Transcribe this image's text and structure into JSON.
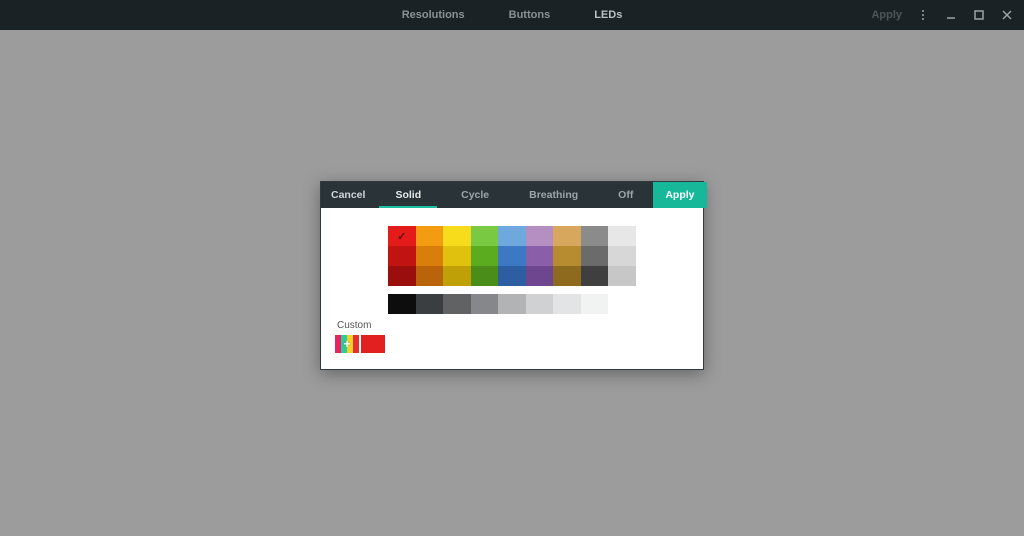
{
  "header": {
    "tabs": [
      {
        "label": "Resolutions",
        "active": false
      },
      {
        "label": "Buttons",
        "active": false
      },
      {
        "label": "LEDs",
        "active": true
      }
    ],
    "apply_label": "Apply"
  },
  "dialog": {
    "cancel_label": "Cancel",
    "apply_label": "Apply",
    "tabs": [
      {
        "label": "Solid",
        "active": true
      },
      {
        "label": "Cycle",
        "active": false
      },
      {
        "label": "Breathing",
        "active": false
      },
      {
        "label": "Off",
        "active": false
      }
    ],
    "palette": {
      "rows": [
        [
          {
            "hex": "#e31b1b",
            "selected": true
          },
          {
            "hex": "#f39c12"
          },
          {
            "hex": "#f7dc1b"
          },
          {
            "hex": "#7ac943"
          },
          {
            "hex": "#6fa8dc"
          },
          {
            "hex": "#b58fc1"
          },
          {
            "hex": "#d6a75c"
          },
          {
            "hex": "#8b8b8b"
          },
          {
            "hex": "#e7e7e7"
          }
        ],
        [
          {
            "hex": "#c21313"
          },
          {
            "hex": "#d97e0b"
          },
          {
            "hex": "#e0c20e"
          },
          {
            "hex": "#5bad1f"
          },
          {
            "hex": "#3c78c4"
          },
          {
            "hex": "#8a5ea9"
          },
          {
            "hex": "#b78b30"
          },
          {
            "hex": "#6b6b6b"
          },
          {
            "hex": "#d7d7d7"
          }
        ],
        [
          {
            "hex": "#9a0e0e"
          },
          {
            "hex": "#b9640a"
          },
          {
            "hex": "#c0a007"
          },
          {
            "hex": "#4b8d19"
          },
          {
            "hex": "#2d5ea2"
          },
          {
            "hex": "#6e4690"
          },
          {
            "hex": "#8d6a1e"
          },
          {
            "hex": "#3f3f3f"
          },
          {
            "hex": "#c7c7c7"
          }
        ]
      ],
      "neutral_row": [
        {
          "hex": "#0d0d0d"
        },
        {
          "hex": "#3b3e40"
        },
        {
          "hex": "#606264"
        },
        {
          "hex": "#85878a"
        },
        {
          "hex": "#b1b3b5"
        },
        {
          "hex": "#cfd1d2"
        },
        {
          "hex": "#e3e4e5"
        },
        {
          "hex": "#f1f2f2"
        },
        {
          "hex": "#ffffff"
        }
      ]
    },
    "custom": {
      "label": "Custom",
      "add_stripes": [
        "#e8235e",
        "#2ecc9b",
        "#f4d12a",
        "#e82f2f"
      ],
      "swatches": [
        {
          "hex": "#e32020"
        }
      ]
    }
  }
}
